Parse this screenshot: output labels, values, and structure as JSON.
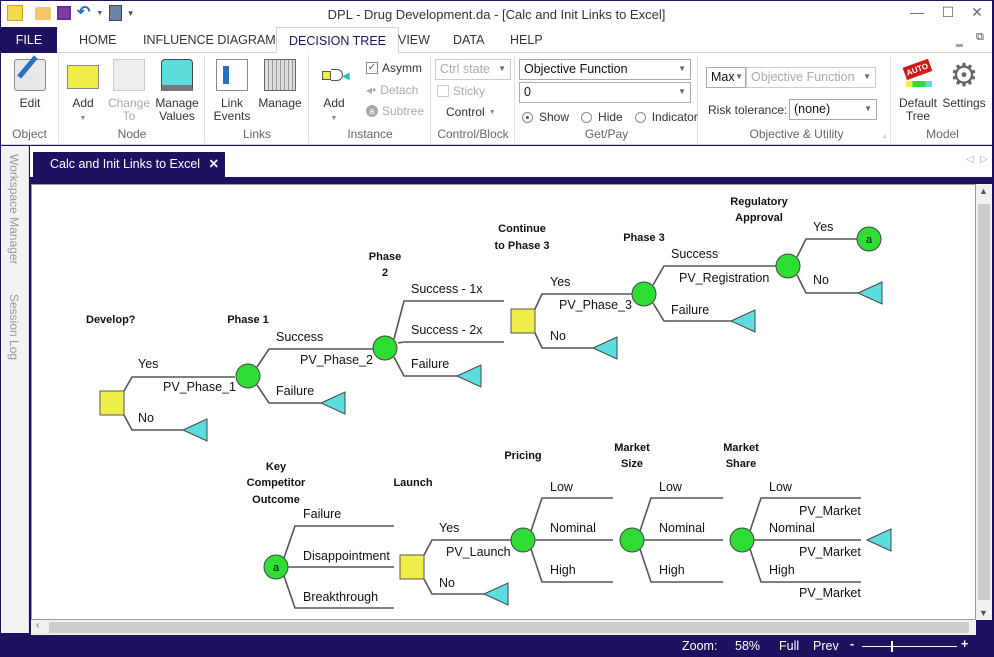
{
  "window": {
    "title": "DPL - Drug Development.da - [Calc and Init Links to Excel]",
    "controls": [
      "minimize",
      "maximize",
      "close"
    ]
  },
  "menu": {
    "tabs": [
      {
        "label": "FILE"
      },
      {
        "label": "HOME"
      },
      {
        "label": "INFLUENCE DIAGRAM"
      },
      {
        "label": "DECISION TREE",
        "active": true
      },
      {
        "label": "VIEW"
      },
      {
        "label": "DATA"
      },
      {
        "label": "HELP"
      }
    ]
  },
  "ribbon": {
    "object": {
      "label": "Object",
      "edit": "Edit"
    },
    "node": {
      "label": "Node",
      "add": "Add",
      "change_to": "Change To",
      "manage_values": "Manage Values"
    },
    "links": {
      "label": "Links",
      "link_events": "Link Events",
      "manage": "Manage"
    },
    "instance": {
      "label": "Instance",
      "add": "Add",
      "asymm": "Asymm",
      "asymm_checked": true,
      "detach": "Detach",
      "subtree": "Subtree"
    },
    "control_block": {
      "label": "Control/Block",
      "ctrl_state_placeholder": "Ctrl state",
      "sticky": "Sticky",
      "control": "Control"
    },
    "get_pay": {
      "label": "Get/Pay",
      "function_value": "Objective Function",
      "index_value": "0",
      "show": "Show",
      "hide": "Hide",
      "indicator": "Indicator",
      "selected": "Show"
    },
    "objective": {
      "label": "Objective & Utility",
      "mode": "Max",
      "function": "Objective Function",
      "risk_label": "Risk tolerance:",
      "risk_value": "(none)"
    },
    "model": {
      "label": "Model",
      "default_tree": "Default Tree",
      "settings": "Settings",
      "auto_badge": "AUTO"
    }
  },
  "side_panels": [
    "Workspace Manager",
    "Session Log"
  ],
  "document_tab": {
    "label": "Calc and Init Links to Excel"
  },
  "status": {
    "zoom_label": "Zoom:",
    "zoom_value": "58%",
    "full": "Full",
    "prev": "Prev",
    "zoom_fraction": 0.3
  },
  "tree": {
    "node_labels": {
      "develop": "Develop?",
      "phase1": "Phase 1",
      "phase2": "Phase 2",
      "continue": "Continue to Phase 3",
      "phase3": "Phase 3",
      "regulatory": "Regulatory Approval",
      "competitor": "Key Competitor Outcome",
      "launch": "Launch",
      "pricing": "Pricing",
      "market_size": "Market Size",
      "market_share": "Market Share"
    },
    "branches": {
      "yes": "Yes",
      "no": "No",
      "success": "Success",
      "failure": "Failure",
      "success_1x": "Success - 1x",
      "success_2x": "Success - 2x",
      "disappointment": "Disappointment",
      "breakthrough": "Breakthrough",
      "low": "Low",
      "nominal": "Nominal",
      "high": "High"
    },
    "values": {
      "pv1": "PV_Phase_1",
      "pv2": "PV_Phase_2",
      "pv3": "PV_Phase_3",
      "pvreg": "PV_Registration",
      "pvlaunch": "PV_Launch",
      "pvmarket": "PV_Market"
    },
    "subtree_ref": "a",
    "colors": {
      "decision": "#f0ef4a",
      "chance": "#2ede34",
      "terminal": "#5cdedf",
      "line": "#555555"
    }
  }
}
